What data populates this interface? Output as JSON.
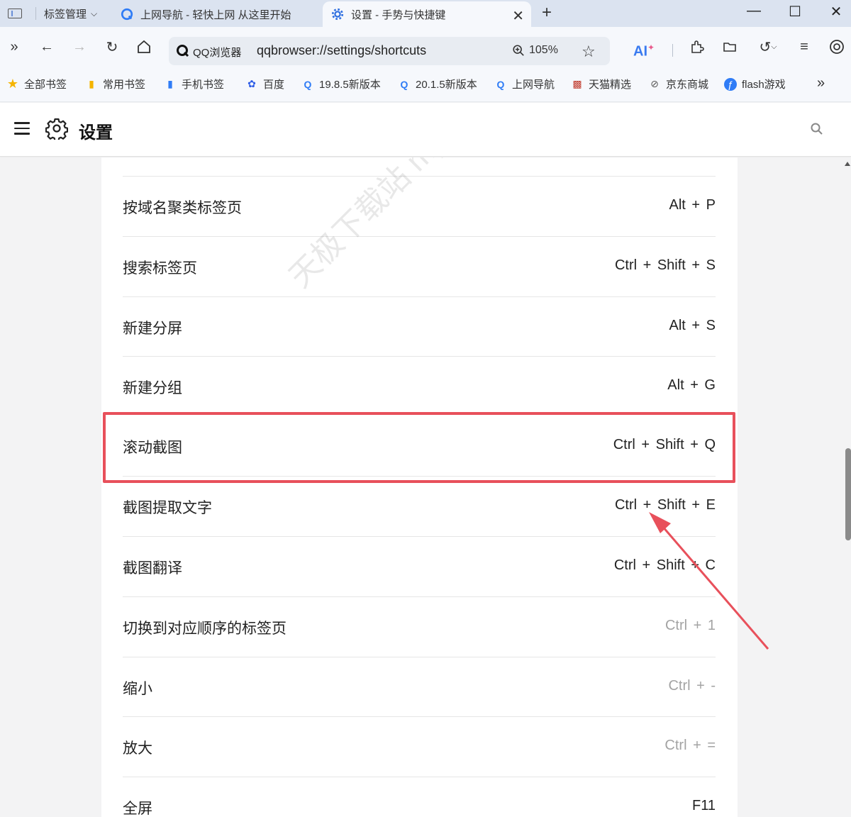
{
  "tabstrip": {
    "tab_manager_label": "标签管理",
    "tabs": [
      {
        "title": "上网导航 - 轻快上网 从这里开始",
        "active": false
      },
      {
        "title": "设置 - 手势与快捷键",
        "active": true
      }
    ]
  },
  "toolbar": {
    "brand": "QQ浏览器",
    "url": "qqbrowser://settings/shortcuts",
    "zoom": "105%",
    "ai_label": "AI"
  },
  "bookmarks": [
    {
      "label": "全部书签",
      "icon": "star-icon"
    },
    {
      "label": "常用书签",
      "icon": "bookmark-icon"
    },
    {
      "label": "手机书签",
      "icon": "phone-icon"
    },
    {
      "label": "百度",
      "icon": "baidu-icon"
    },
    {
      "label": "19.8.5新版本",
      "icon": "qqbrowser-icon"
    },
    {
      "label": "20.1.5新版本",
      "icon": "qqbrowser-icon"
    },
    {
      "label": "上网导航",
      "icon": "qqbrowser-icon"
    },
    {
      "label": "天猫精选",
      "icon": "tmall-icon"
    },
    {
      "label": "京东商城",
      "icon": "jd-icon"
    },
    {
      "label": "flash游戏",
      "icon": "flash-icon"
    }
  ],
  "settings": {
    "title": "设置"
  },
  "shortcuts": [
    {
      "label": "按域名聚类标签页",
      "keys": "Alt + P",
      "muted": false,
      "highlighted": false
    },
    {
      "label": "搜索标签页",
      "keys": "Ctrl + Shift + S",
      "muted": false,
      "highlighted": false
    },
    {
      "label": "新建分屏",
      "keys": "Alt + S",
      "muted": false,
      "highlighted": false
    },
    {
      "label": "新建分组",
      "keys": "Alt + G",
      "muted": false,
      "highlighted": false
    },
    {
      "label": "滚动截图",
      "keys": "Ctrl + Shift + Q",
      "muted": false,
      "highlighted": true
    },
    {
      "label": "截图提取文字",
      "keys": "Ctrl + Shift + E",
      "muted": false,
      "highlighted": false
    },
    {
      "label": "截图翻译",
      "keys": "Ctrl + Shift + C",
      "muted": false,
      "highlighted": false
    },
    {
      "label": "切换到对应顺序的标签页",
      "keys": "Ctrl + 1",
      "muted": true,
      "highlighted": false
    },
    {
      "label": "缩小",
      "keys": "Ctrl + -",
      "muted": true,
      "highlighted": false
    },
    {
      "label": "放大",
      "keys": "Ctrl + =",
      "muted": true,
      "highlighted": false
    },
    {
      "label": "全屏",
      "keys": "F11",
      "muted": false,
      "highlighted": false
    }
  ],
  "watermark": "天极下载站 mydown.yesky.com",
  "colors": {
    "highlight": "#e8505b",
    "accent": "#3a7bf0"
  }
}
